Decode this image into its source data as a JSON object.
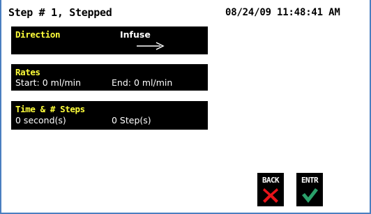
{
  "header": {
    "title": "Step # 1, Stepped",
    "datetime": "08/24/09 11:48:41 AM"
  },
  "direction_panel": {
    "heading": "Direction",
    "value": "Infuse",
    "icon": "right-arrow-icon"
  },
  "rates_panel": {
    "heading": "Rates",
    "start": "Start: 0 ml/min",
    "end": "End: 0 ml/min"
  },
  "time_panel": {
    "heading": "Time & # Steps",
    "time": "0 second(s)",
    "steps": "0 Step(s)"
  },
  "buttons": {
    "back": {
      "label": "BACK",
      "icon": "red-x-icon",
      "color": "#e8141a"
    },
    "enter": {
      "label": "ENTR",
      "icon": "green-check-icon",
      "color": "#2aa06a"
    }
  },
  "colors": {
    "panel_bg": "#000000",
    "heading": "#ffff3a",
    "frame": "#4a7fc0"
  }
}
